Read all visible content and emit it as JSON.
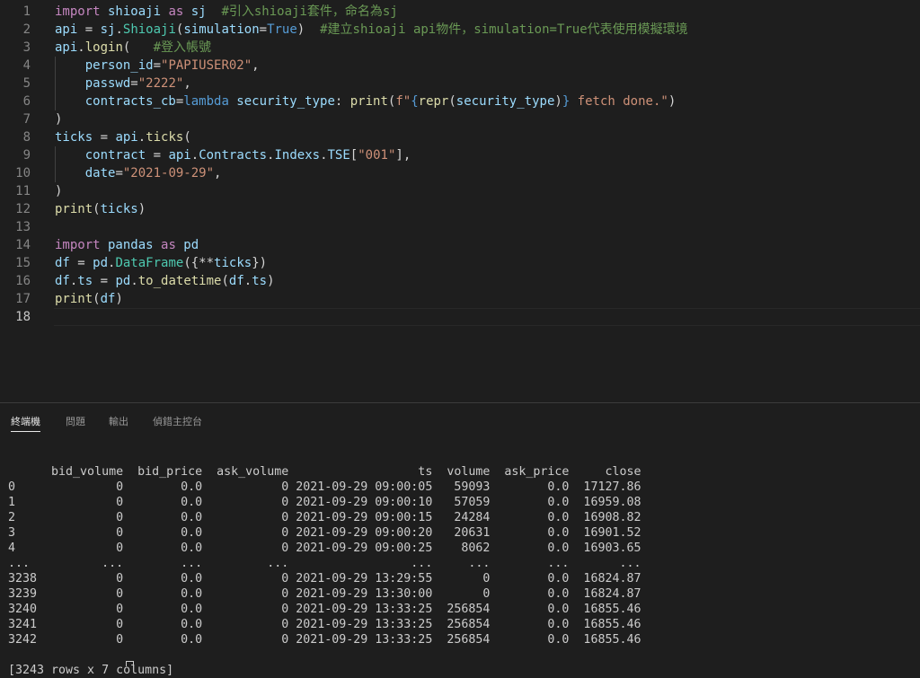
{
  "editor": {
    "line_numbers": [
      "1",
      "2",
      "3",
      "4",
      "5",
      "6",
      "7",
      "8",
      "9",
      "10",
      "11",
      "12",
      "13",
      "14",
      "15",
      "16",
      "17",
      "18"
    ],
    "lines": [
      [
        {
          "t": "import",
          "c": "kw"
        },
        {
          "t": " shioaji ",
          "c": "id"
        },
        {
          "t": "as",
          "c": "kw"
        },
        {
          "t": " sj  ",
          "c": "id"
        },
        {
          "t": "#引入shioaji套件，命名為sj",
          "c": "cm"
        }
      ],
      [
        {
          "t": "api",
          "c": "id"
        },
        {
          "t": " = ",
          "c": "op"
        },
        {
          "t": "sj",
          "c": "id"
        },
        {
          "t": ".",
          "c": "op"
        },
        {
          "t": "Shioaji",
          "c": "cls"
        },
        {
          "t": "(",
          "c": "op"
        },
        {
          "t": "simulation",
          "c": "id"
        },
        {
          "t": "=",
          "c": "op"
        },
        {
          "t": "True",
          "c": "bl"
        },
        {
          "t": ")  ",
          "c": "op"
        },
        {
          "t": "#建立shioaji api物件，simulation=True代表使用模擬環境",
          "c": "cm"
        }
      ],
      [
        {
          "t": "api",
          "c": "id"
        },
        {
          "t": ".",
          "c": "op"
        },
        {
          "t": "login",
          "c": "fn"
        },
        {
          "t": "(   ",
          "c": "op"
        },
        {
          "t": "#登入帳號",
          "c": "cm"
        }
      ],
      [
        {
          "t": "    person_id",
          "c": "id"
        },
        {
          "t": "=",
          "c": "op"
        },
        {
          "t": "\"PAPIUSER02\"",
          "c": "str"
        },
        {
          "t": ",",
          "c": "op"
        }
      ],
      [
        {
          "t": "    passwd",
          "c": "id"
        },
        {
          "t": "=",
          "c": "op"
        },
        {
          "t": "\"2222\"",
          "c": "str"
        },
        {
          "t": ",",
          "c": "op"
        }
      ],
      [
        {
          "t": "    contracts_cb",
          "c": "id"
        },
        {
          "t": "=",
          "c": "op"
        },
        {
          "t": "lambda",
          "c": "bl"
        },
        {
          "t": " security_type",
          "c": "id"
        },
        {
          "t": ": ",
          "c": "op"
        },
        {
          "t": "print",
          "c": "fn"
        },
        {
          "t": "(",
          "c": "op"
        },
        {
          "t": "f\"",
          "c": "str"
        },
        {
          "t": "{",
          "c": "bl"
        },
        {
          "t": "repr",
          "c": "fn"
        },
        {
          "t": "(",
          "c": "op"
        },
        {
          "t": "security_type",
          "c": "id"
        },
        {
          "t": ")",
          "c": "op"
        },
        {
          "t": "}",
          "c": "bl"
        },
        {
          "t": " fetch done.\"",
          "c": "str"
        },
        {
          "t": ")",
          "c": "op"
        }
      ],
      [
        {
          "t": ")",
          "c": "op"
        }
      ],
      [
        {
          "t": "ticks",
          "c": "id"
        },
        {
          "t": " = ",
          "c": "op"
        },
        {
          "t": "api",
          "c": "id"
        },
        {
          "t": ".",
          "c": "op"
        },
        {
          "t": "ticks",
          "c": "fn"
        },
        {
          "t": "(",
          "c": "op"
        }
      ],
      [
        {
          "t": "    contract",
          "c": "id"
        },
        {
          "t": " = ",
          "c": "op"
        },
        {
          "t": "api",
          "c": "id"
        },
        {
          "t": ".",
          "c": "op"
        },
        {
          "t": "Contracts",
          "c": "id"
        },
        {
          "t": ".",
          "c": "op"
        },
        {
          "t": "Indexs",
          "c": "id"
        },
        {
          "t": ".",
          "c": "op"
        },
        {
          "t": "TSE",
          "c": "id"
        },
        {
          "t": "[",
          "c": "op"
        },
        {
          "t": "\"001\"",
          "c": "str"
        },
        {
          "t": "],",
          "c": "op"
        }
      ],
      [
        {
          "t": "    date",
          "c": "id"
        },
        {
          "t": "=",
          "c": "op"
        },
        {
          "t": "\"2021-09-29\"",
          "c": "str"
        },
        {
          "t": ",",
          "c": "op"
        }
      ],
      [
        {
          "t": ")",
          "c": "op"
        }
      ],
      [
        {
          "t": "print",
          "c": "fn"
        },
        {
          "t": "(",
          "c": "op"
        },
        {
          "t": "ticks",
          "c": "id"
        },
        {
          "t": ")",
          "c": "op"
        }
      ],
      [],
      [
        {
          "t": "import",
          "c": "kw"
        },
        {
          "t": " pandas ",
          "c": "id"
        },
        {
          "t": "as",
          "c": "kw"
        },
        {
          "t": " pd",
          "c": "id"
        }
      ],
      [
        {
          "t": "df",
          "c": "id"
        },
        {
          "t": " = ",
          "c": "op"
        },
        {
          "t": "pd",
          "c": "id"
        },
        {
          "t": ".",
          "c": "op"
        },
        {
          "t": "DataFrame",
          "c": "cls"
        },
        {
          "t": "({**",
          "c": "op"
        },
        {
          "t": "ticks",
          "c": "id"
        },
        {
          "t": "})",
          "c": "op"
        }
      ],
      [
        {
          "t": "df",
          "c": "id"
        },
        {
          "t": ".",
          "c": "op"
        },
        {
          "t": "ts",
          "c": "id"
        },
        {
          "t": " = ",
          "c": "op"
        },
        {
          "t": "pd",
          "c": "id"
        },
        {
          "t": ".",
          "c": "op"
        },
        {
          "t": "to_datetime",
          "c": "fn"
        },
        {
          "t": "(",
          "c": "op"
        },
        {
          "t": "df",
          "c": "id"
        },
        {
          "t": ".",
          "c": "op"
        },
        {
          "t": "ts",
          "c": "id"
        },
        {
          "t": ")",
          "c": "op"
        }
      ],
      [
        {
          "t": "print",
          "c": "fn"
        },
        {
          "t": "(",
          "c": "op"
        },
        {
          "t": "df",
          "c": "id"
        },
        {
          "t": ")",
          "c": "op"
        }
      ],
      []
    ]
  },
  "panel": {
    "tabs": [
      {
        "label": "終端機",
        "active": true
      },
      {
        "label": "問題",
        "active": false
      },
      {
        "label": "輸出",
        "active": false
      },
      {
        "label": "偵錯主控台",
        "active": false
      }
    ],
    "terminal_lines": [
      "",
      "      bid_volume  bid_price  ask_volume                  ts  volume  ask_price     close",
      "0              0        0.0           0 2021-09-29 09:00:05   59093        0.0  17127.86",
      "1              0        0.0           0 2021-09-29 09:00:10   57059        0.0  16959.08",
      "2              0        0.0           0 2021-09-29 09:00:15   24284        0.0  16908.82",
      "3              0        0.0           0 2021-09-29 09:00:20   20631        0.0  16901.52",
      "4              0        0.0           0 2021-09-29 09:00:25    8062        0.0  16903.65",
      "...          ...        ...         ...                 ...     ...        ...       ...",
      "3238           0        0.0           0 2021-09-29 13:29:55       0        0.0  16824.87",
      "3239           0        0.0           0 2021-09-29 13:30:00       0        0.0  16824.87",
      "3240           0        0.0           0 2021-09-29 13:33:25  256854        0.0  16855.46",
      "3241           0        0.0           0 2021-09-29 13:33:25  256854        0.0  16855.46",
      "3242           0        0.0           0 2021-09-29 13:33:25  256854        0.0  16855.46",
      "",
      "[3243 rows x 7 columns]"
    ]
  }
}
